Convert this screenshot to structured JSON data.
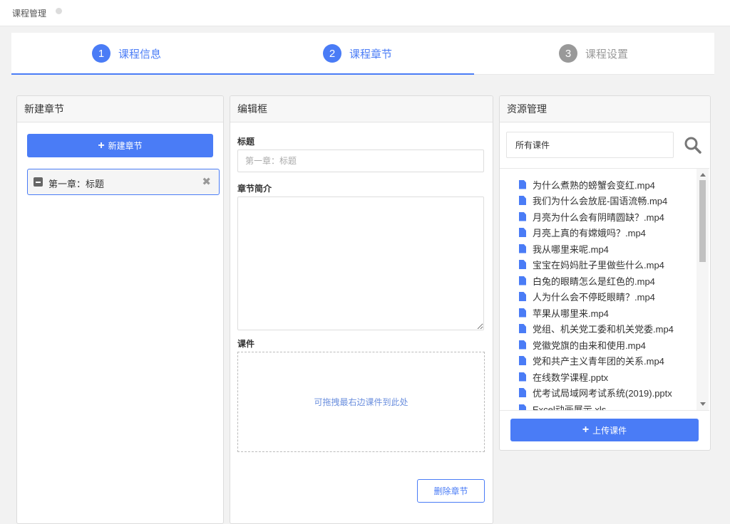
{
  "tab": {
    "label": "课程管理"
  },
  "steps": [
    {
      "num": "1",
      "label": "课程信息"
    },
    {
      "num": "2",
      "label": "课程章节"
    },
    {
      "num": "3",
      "label": "课程设置"
    }
  ],
  "chapter_panel": {
    "title": "新建章节",
    "new_button": "新建章节",
    "items": [
      {
        "label": "第一章：标题"
      }
    ]
  },
  "editor": {
    "title": "编辑框",
    "title_label": "标题",
    "title_placeholder": "第一章：标题",
    "intro_label": "章节简介",
    "courseware_label": "课件",
    "drop_hint": "可拖拽最右边课件到此处",
    "delete_button": "删除章节"
  },
  "resources": {
    "title": "资源管理",
    "search_value": "所有课件",
    "files": [
      "为什么煮熟的螃蟹会变红.mp4",
      "我们为什么会放屁-国语流畅.mp4",
      "月亮为什么会有阴晴圆缺？.mp4",
      "月亮上真的有嫦娥吗？.mp4",
      "我从哪里来呢.mp4",
      "宝宝在妈妈肚子里做些什么.mp4",
      "白兔的眼睛怎么是红色的.mp4",
      "人为什么会不停眨眼睛？.mp4",
      "苹果从哪里来.mp4",
      "党组、机关党工委和机关党委.mp4",
      "党徽党旗的由来和使用.mp4",
      "党和共产主义青年团的关系.mp4",
      "在线数学课程.pptx",
      "优考试局域网考试系统(2019).pptx",
      "Excel动画展示.xls"
    ],
    "upload_button": "上传课件"
  },
  "colors": {
    "accent": "#4a7cf6",
    "inactive": "#999999"
  },
  "icons": [
    "plus-icon",
    "collapse-icon",
    "close-icon",
    "search-icon",
    "file-icon"
  ]
}
